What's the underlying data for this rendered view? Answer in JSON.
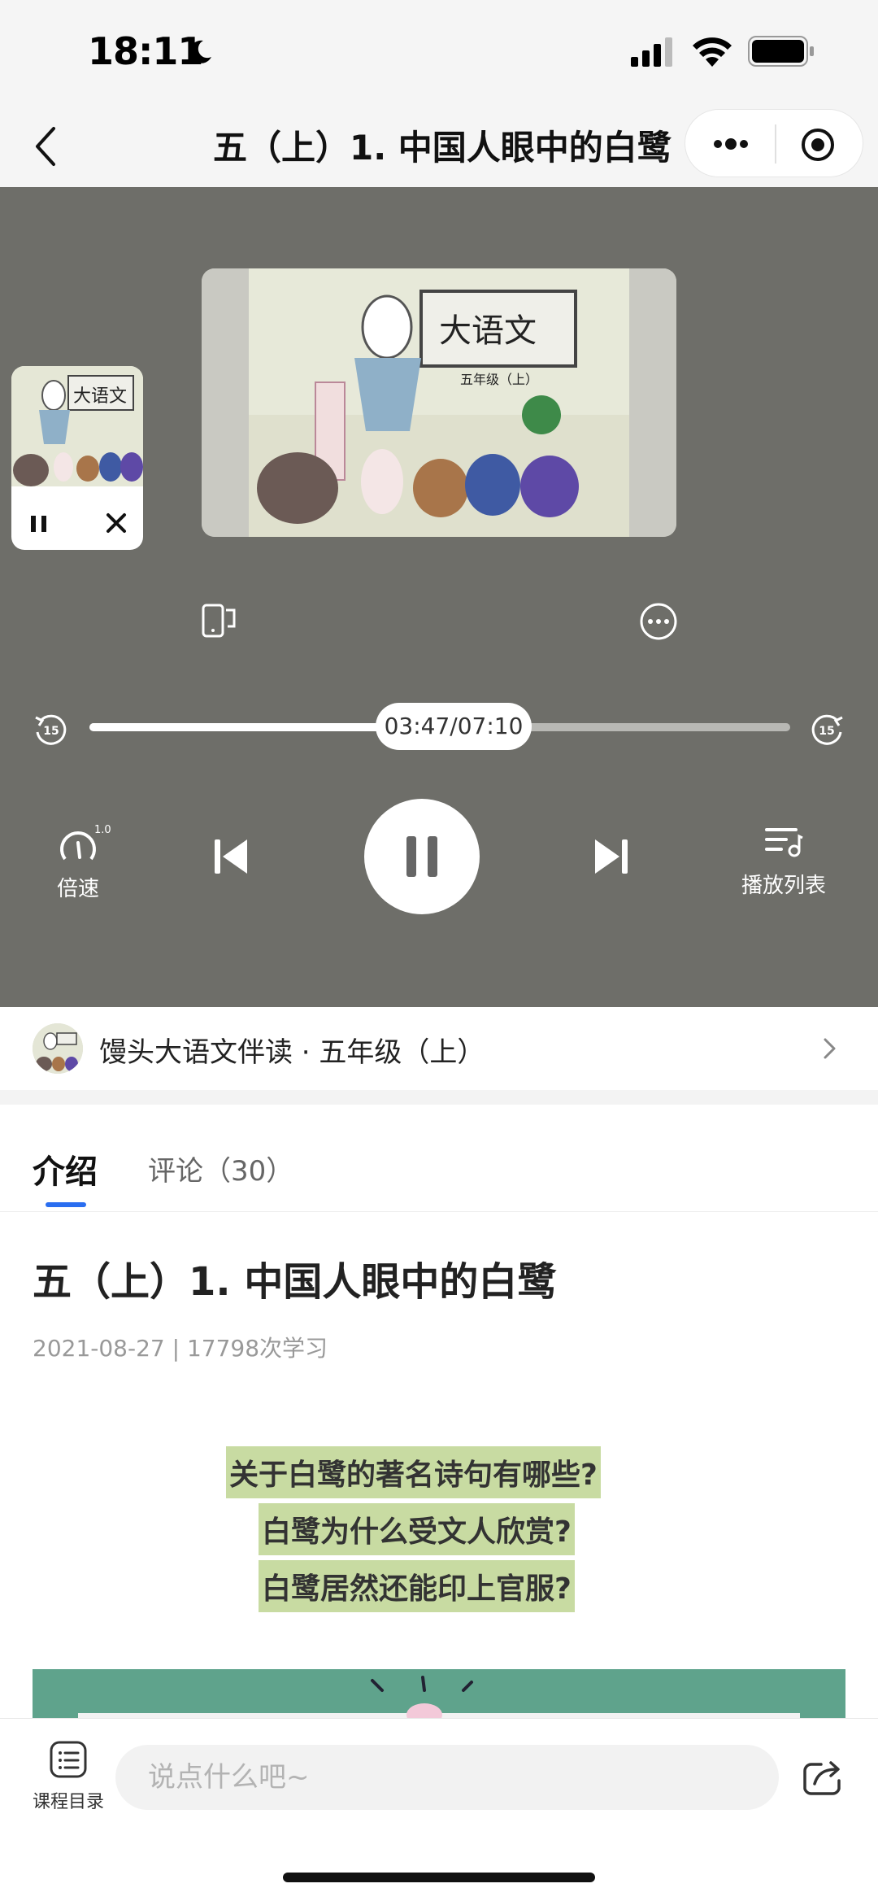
{
  "status_bar": {
    "time": "18:11"
  },
  "nav": {
    "title": "五（上）1. 中国人眼中的白鹭"
  },
  "player": {
    "cover_sign_text": "大语文",
    "cover_sign_subtitle": "五年级（上）",
    "time_display": "03:47/07:10",
    "progress": 0.528,
    "rewind_seconds": "15",
    "forward_seconds": "15",
    "speed_badge": "1.0x",
    "speed_label": "倍速",
    "playlist_label": "播放列表"
  },
  "course": {
    "title": "馒头大语文伴读 · 五年级（上）"
  },
  "tabs": {
    "intro": "介绍",
    "comments": "评论（30）"
  },
  "lesson": {
    "title": "五（上）1. 中国人眼中的白鹭",
    "meta": "2021-08-27 | 17798次学习",
    "highlights": [
      "关于白鹭的著名诗句有哪些?",
      "白鹭为什么受文人欣赏?",
      "白鹭居然还能印上官服?"
    ]
  },
  "bottom": {
    "catalog_label": "课程目录",
    "input_placeholder": "说点什么吧~"
  },
  "colors": {
    "accent": "#2a6ef0",
    "player_bg": "#6e6e69",
    "highlight_bg": "#c8dba2",
    "banner": "#5fa38c"
  }
}
